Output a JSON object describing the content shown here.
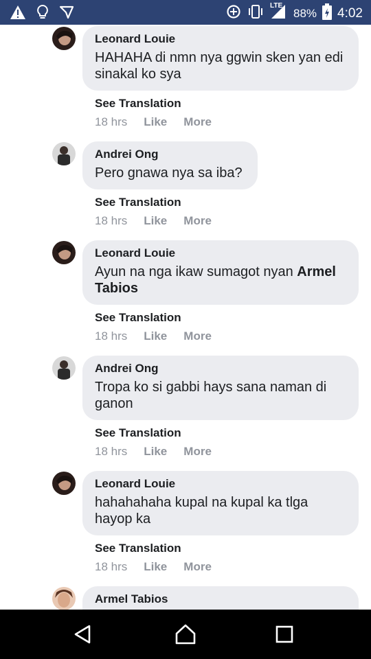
{
  "status_bar": {
    "battery": "88%",
    "time": "4:02",
    "network": "LTE",
    "left_icons": [
      "warning-icon",
      "lightbulb-icon",
      "messenger-icon"
    ],
    "right_icons": [
      "data-saver-icon",
      "vibrate-icon",
      "signal-icon",
      "battery-icon"
    ]
  },
  "comments": [
    {
      "author": "Leonard Louie",
      "text": "HAHAHA di nmn nya ggwin sken yan edi sinakal ko sya",
      "see_translation": "See Translation",
      "time": "18 hrs",
      "like": "Like",
      "more": "More"
    },
    {
      "author": "Andrei Ong",
      "text": "Pero gnawa nya sa iba?",
      "see_translation": "See Translation",
      "time": "18 hrs",
      "like": "Like",
      "more": "More"
    },
    {
      "author": "Leonard Louie",
      "text": "Ayun na nga ikaw sumagot nyan",
      "mention": "Armel Tabios",
      "see_translation": "See Translation",
      "time": "18 hrs",
      "like": "Like",
      "more": "More"
    },
    {
      "author": "Andrei Ong",
      "text": "Tropa ko si gabbi hays sana naman di ganon",
      "see_translation": "See Translation",
      "time": "18 hrs",
      "like": "Like",
      "more": "More"
    },
    {
      "author": "Leonard Louie",
      "text": "hahahahaha kupal na kupal ka tlga hayop ka",
      "see_translation": "See Translation",
      "time": "18 hrs",
      "like": "Like",
      "more": "More"
    },
    {
      "author": "Armel Tabios"
    }
  ],
  "nav": {
    "icons": [
      "back-icon",
      "home-icon",
      "recents-icon"
    ]
  }
}
